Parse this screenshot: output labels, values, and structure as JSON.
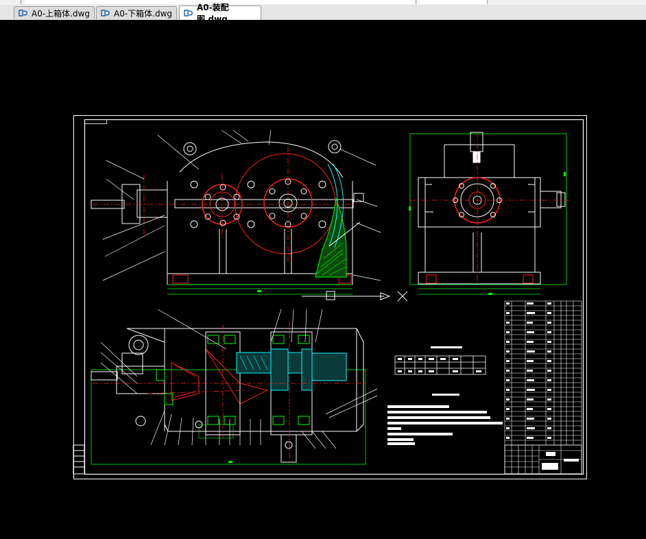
{
  "tabs": [
    {
      "label": "A0-上箱体.dwg",
      "active": false
    },
    {
      "label": "A0-下箱体.dwg",
      "active": false
    },
    {
      "label": "A0-装配图.dwg",
      "active": true
    }
  ],
  "icons": {
    "tab_file": "dwg-file-icon",
    "crosshair": "ucs-crosshair-icon"
  },
  "colors": {
    "background": "#000000",
    "frame": "#ffffff",
    "accent_red": "#ff2020",
    "accent_green": "#00ff00",
    "accent_cyan": "#00ffff"
  }
}
